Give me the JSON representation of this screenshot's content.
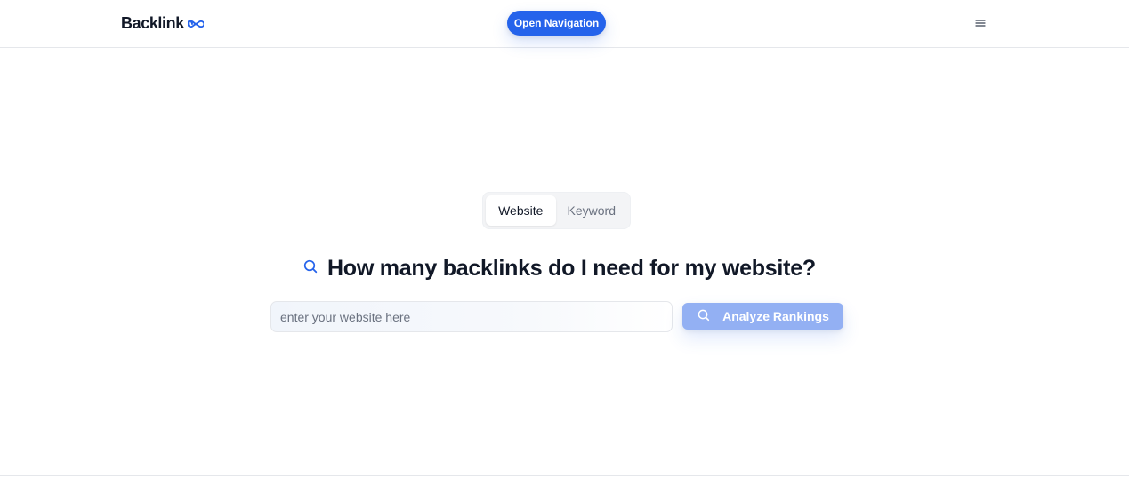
{
  "header": {
    "logo_text": "Backlink",
    "logo_icon": "infinity-icon",
    "open_navigation_label": "Open Navigation",
    "menu_icon": "hamburger-menu-icon"
  },
  "tabs": [
    {
      "label": "Website",
      "active": true
    },
    {
      "label": "Keyword",
      "active": false
    }
  ],
  "hero": {
    "icon": "search-icon",
    "headline": "How many backlinks do I need for my website?"
  },
  "search": {
    "value": "",
    "placeholder": "enter your website here",
    "button_label": "Analyze Rankings",
    "button_icon": "search-icon"
  },
  "colors": {
    "accent": "#2563eb",
    "accent_disabled": "#93b0f3",
    "text": "#111827",
    "muted_text": "#6b7280",
    "border": "#e5e7eb"
  }
}
